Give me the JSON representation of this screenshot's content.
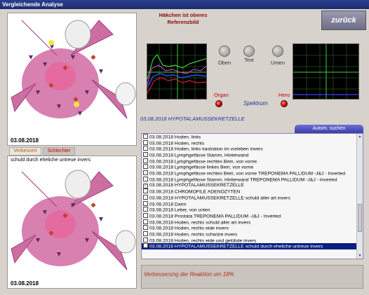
{
  "window": {
    "title": "Vergleichende Analyse"
  },
  "left": {
    "top_date": "03.08.2018",
    "tab_better": "Verbessert",
    "tab_worse": "Schlechter",
    "annotation": "schuld durch eheliche untreue invers",
    "bottom_date": "03.08.2018"
  },
  "hint": "Häkchen ist oberes Referenzbild",
  "back_label": "zurück",
  "knobs": {
    "oben": "Oben",
    "text": "Text",
    "unten": "Unten"
  },
  "leds": {
    "organ": "Organ",
    "hero": "Hero"
  },
  "spektrum_label": "Spektrum",
  "selection_title": "03.08.2018 HYPOTALAMUSSEKRETZELLE",
  "search_label": "Autom. suchen",
  "list": [
    {
      "text": "03.08.2018  Hoden, links",
      "checked": false
    },
    {
      "text": "03.08.2018  Hoden, rechts",
      "checked": false
    },
    {
      "text": "03.08.2018  Hoden, links  kastration im vorleben invers",
      "checked": false
    },
    {
      "text": "03.08.2018  Lymphgefässe Stamm, Hinterwand",
      "checked": false
    },
    {
      "text": "03.08.2018  Lymphgefässe rechtes Bein, von vorne",
      "checked": false
    },
    {
      "text": "03.08.2018  Lymphgefässe linkes Bein, von vorne",
      "checked": false
    },
    {
      "text": "03.08.2018  Lymphgefässe rechtes Bein, von vorne  TREPONEMA  PALLIDUM  -J&J - Inverted",
      "checked": false
    },
    {
      "text": "03.08.2018  Lymphgefässe Stamm, Hinterwand  TREPONEMA  PALLIDUM  -J&J - Inverted",
      "checked": false
    },
    {
      "text": "03.08.2018  HYPOTALAMUSSEKRETZELLE",
      "checked": true
    },
    {
      "text": "03.08.2018  CHROMOFILE ADENOZYTEN",
      "checked": false
    },
    {
      "text": "03.08.2018  HYPOTALAMUSSEKRETZELLE  schuld aller art invers",
      "checked": false
    },
    {
      "text": "03.08.2018  Darm",
      "checked": false
    },
    {
      "text": "03.08.2018  Leber, von unten",
      "checked": false
    },
    {
      "text": "03.08.2018  Prostata  TREPONEMA  PALLIDUM  -J&J - Inverted",
      "checked": false
    },
    {
      "text": "03.08.2018  Hoden, rechts  schuld aller art invers",
      "checked": false
    },
    {
      "text": "03.08.2018  Hoden, rechts  eide invers",
      "checked": false
    },
    {
      "text": "03.08.2018  Hoden, rechts  schwüre invers",
      "checked": false
    },
    {
      "text": "03.08.2018  Hoden, rechts  eide und gelübde invers",
      "checked": false
    },
    {
      "text": "03.08.2018  HYPOTALAMUSSEKRETZELLE  schuld durch eheliche untreue invers",
      "checked": false,
      "selected": true
    }
  ],
  "improvement": "Verbesserung der Reaktion um 18%",
  "colors": {
    "title_bar": "#1c2c70",
    "selection": "#0b1f80",
    "hint": "#8b0a10",
    "led": "#c00000"
  }
}
